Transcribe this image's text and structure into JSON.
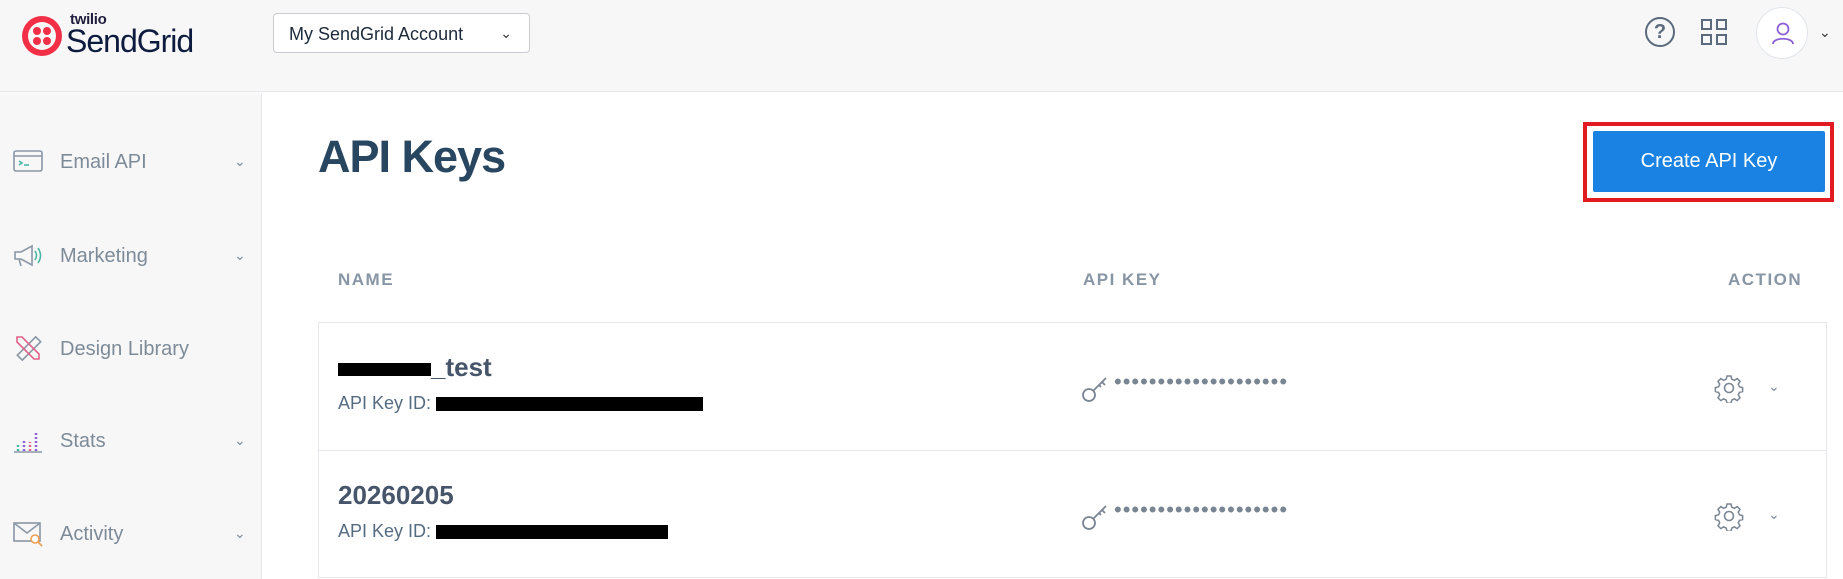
{
  "brand": {
    "small": "twilio",
    "main": "SendGrid"
  },
  "header": {
    "account_label": "My SendGrid Account",
    "help_icon": "help-circle-icon",
    "apps_icon": "app-grid-icon",
    "avatar_icon": "user-icon"
  },
  "sidebar": {
    "items": [
      {
        "label": "Email API",
        "icon": "terminal-window-icon",
        "expandable": true
      },
      {
        "label": "Marketing",
        "icon": "megaphone-icon",
        "expandable": true
      },
      {
        "label": "Design Library",
        "icon": "pencil-ruler-icon",
        "expandable": false
      },
      {
        "label": "Stats",
        "icon": "bar-chart-icon",
        "expandable": true
      },
      {
        "label": "Activity",
        "icon": "mail-search-icon",
        "expandable": true
      }
    ]
  },
  "main": {
    "title": "API Keys",
    "create_button": "Create API Key",
    "columns": {
      "name": "NAME",
      "api_key": "API KEY",
      "action": "ACTION"
    },
    "rows": [
      {
        "name_suffix": "_test",
        "id_label": "API Key ID:",
        "masked_key": "••••••••••••••••••••"
      },
      {
        "name": "20260205",
        "id_label": "API Key ID:",
        "masked_key": "••••••••••••••••••••"
      }
    ]
  },
  "colors": {
    "accent": "#1a82e2",
    "highlight_frame": "#e21b23",
    "brand_red": "#f22f46",
    "heading": "#294661"
  }
}
